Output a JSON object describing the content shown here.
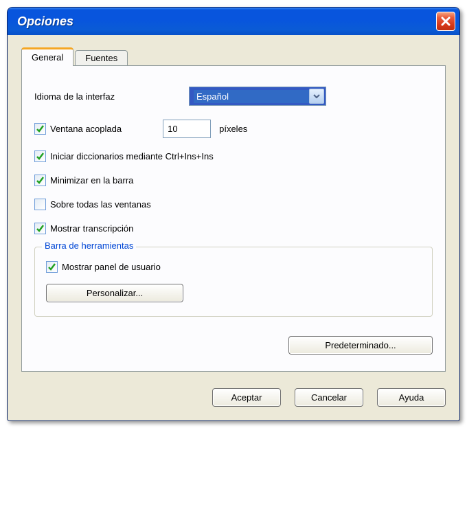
{
  "window": {
    "title": "Opciones"
  },
  "tabs": {
    "general": "General",
    "fuentes": "Fuentes"
  },
  "general": {
    "lang_label": "Idioma de la interfaz",
    "lang_value": "Español",
    "docked": {
      "label": "Ventana acoplada",
      "pixels": "10",
      "unit": "píxeles"
    },
    "ctrlins": {
      "label": "Iniciar diccionarios mediante Ctrl+Ins+Ins"
    },
    "minbar": {
      "label": "Minimizar en la barra"
    },
    "ontop": {
      "label": "Sobre todas las ventanas"
    },
    "transcr": {
      "label": "Mostrar transcripción"
    },
    "toolbar": {
      "title": "Barra de herramientas",
      "userpanel": "Mostrar panel de usuario",
      "customize": "Personalizar..."
    },
    "default_btn": "Predeterminado..."
  },
  "footer": {
    "ok": "Aceptar",
    "cancel": "Cancelar",
    "help": "Ayuda"
  }
}
